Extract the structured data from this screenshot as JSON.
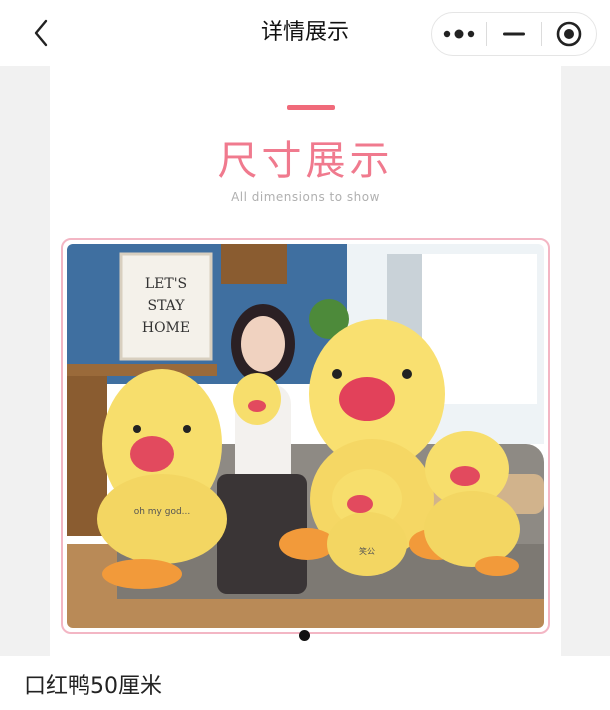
{
  "header": {
    "title": "详情展示",
    "back_icon": "chevron-left-icon",
    "more_icon": "more-dots-icon",
    "minimize_icon": "minimize-icon",
    "close_icon": "target-close-icon"
  },
  "poster": {
    "title": "尺寸展示",
    "subtitle": "All dimensions to show",
    "accent_color": "#f07a8e",
    "sign_text_1": "LET'S",
    "sign_text_2": "STAY",
    "sign_text_3": "HOME",
    "toy_text": "oh my god...",
    "toy_text_2": "笑公"
  },
  "carousel": {
    "active_index": 1,
    "total": 1
  },
  "product": {
    "name": "口红鸭50厘米"
  }
}
